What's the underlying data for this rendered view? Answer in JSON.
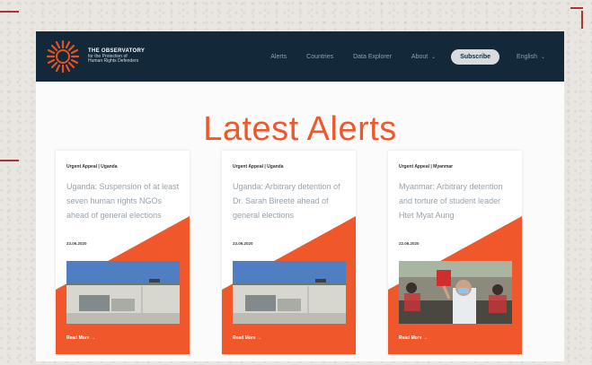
{
  "brand": {
    "title": "THE OBSERVATORY",
    "subtitle_line1": "for the Protection of",
    "subtitle_line2": "Human Rights Defenders",
    "logo_icon": "sunburst-logo-icon"
  },
  "nav": {
    "items": [
      "Alerts",
      "Countries",
      "Data Explorer",
      "About"
    ],
    "about_caret": "⌄",
    "subscribe_label": "Subscribe",
    "language_label": "English",
    "language_caret": "⌄"
  },
  "headline": "Latest Alerts",
  "cards": [
    {
      "category": "Urgent Appeal | Uganda",
      "title": "Uganda: Suspension of at least seven human rights NGOs ahead of general elections",
      "date": "23.06.2020",
      "image": "uganda-building-photo",
      "read_more": "Read More →"
    },
    {
      "category": "Urgent Appeal | Uganda",
      "title": "Uganda: Arbitrary detention of Dr. Sarah Bireete ahead of general elections",
      "date": "23.06.2020",
      "image": "uganda-building-photo",
      "read_more": "Read More →"
    },
    {
      "category": "Urgent Appeal | Myanmar",
      "title": "Myanmar: Arbitrary detention and torture of student leader Htet Myat Aung",
      "date": "22.06.2020",
      "image": "myanmar-protest-photo",
      "read_more": "Read More →"
    }
  ],
  "colors": {
    "accent": "#f0582c",
    "nav_bg": "#13293a",
    "card_title": "#9aa2a8"
  }
}
